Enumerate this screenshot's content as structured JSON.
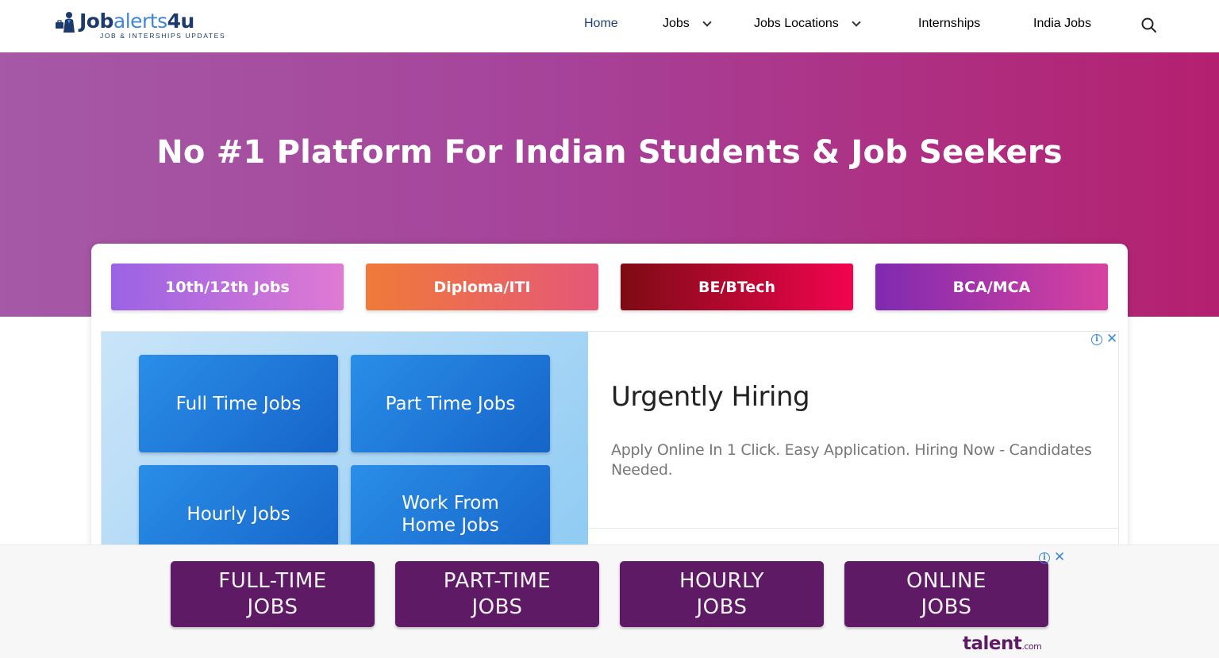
{
  "logo": {
    "word_part1": "Job",
    "word_part2": "alerts",
    "word_part3": "4u",
    "tagline": "JOB & INTERSHIPS UPDATES"
  },
  "nav": {
    "items": [
      {
        "label": "Home",
        "active": true
      },
      {
        "label": "Jobs",
        "has_dropdown": true
      },
      {
        "label": "Jobs Locations",
        "has_dropdown": true
      },
      {
        "label": "Internships"
      },
      {
        "label": "India Jobs"
      }
    ],
    "search_icon": "search-icon",
    "active_color": "#1f3f77"
  },
  "hero": {
    "title": "No #1 Platform For Indian Students & Job Seekers",
    "gradient": [
      "#a559a6",
      "#b4206f"
    ]
  },
  "categories": [
    {
      "label": "10th/12th Jobs"
    },
    {
      "label": "Diploma/ITI"
    },
    {
      "label": "BE/BTech"
    },
    {
      "label": "BCA/MCA"
    }
  ],
  "ad": {
    "tiles": [
      "Full Time Jobs",
      "Part Time Jobs",
      "Hourly Jobs",
      "Work From Home Jobs"
    ],
    "title": "Urgently Hiring",
    "description": "Apply Online In 1 Click. Easy Application. Hiring Now - Candidates Needed.",
    "info_icon": "adchoices-info-icon",
    "close_icon": "close-icon"
  },
  "bottom_ad": {
    "tiles": [
      {
        "line1": "FULL-TIME",
        "line2": "JOBS"
      },
      {
        "line1": "PART-TIME",
        "line2": "JOBS"
      },
      {
        "line1": "HOURLY",
        "line2": "JOBS"
      },
      {
        "line1": "ONLINE",
        "line2": "JOBS"
      }
    ],
    "brand": "talent",
    "brand_suffix": ".com",
    "tile_color": "#5f1a66"
  }
}
